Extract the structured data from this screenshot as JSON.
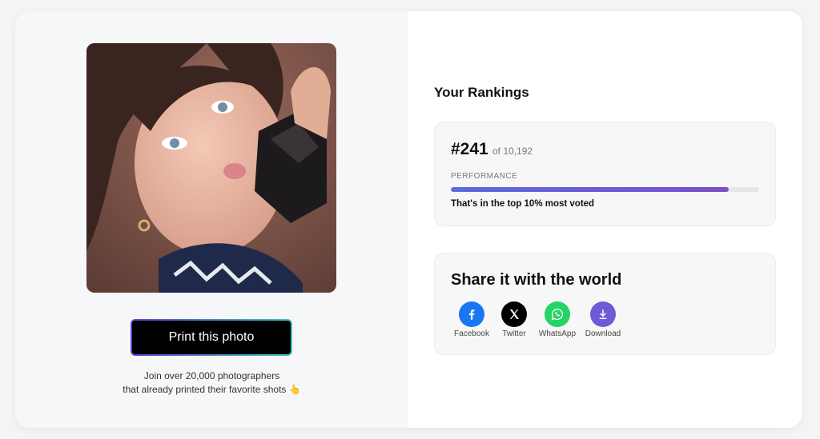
{
  "photo": {
    "alt": "Woman posing with a dark gemstone"
  },
  "print_button": {
    "label": "Print this photo"
  },
  "join": {
    "line1": "Join over 20,000 photographers",
    "line2": "that already printed their favorite shots 👆"
  },
  "rankings": {
    "title": "Your Rankings",
    "rank": "#241",
    "of": "of 10,192",
    "performance_label": "PERFORMANCE",
    "performance_fraction": 0.9,
    "top_text": "That's in the top 10% most voted"
  },
  "share": {
    "title": "Share it with the world",
    "items": [
      {
        "label": "Facebook",
        "icon": "facebook-icon",
        "color": "#1877f2"
      },
      {
        "label": "Twitter",
        "icon": "x-icon",
        "color": "#000000"
      },
      {
        "label": "WhatsApp",
        "icon": "whatsapp-icon",
        "color": "#25d366"
      },
      {
        "label": "Download",
        "icon": "download-icon",
        "color": "#6e5ad6"
      }
    ]
  }
}
